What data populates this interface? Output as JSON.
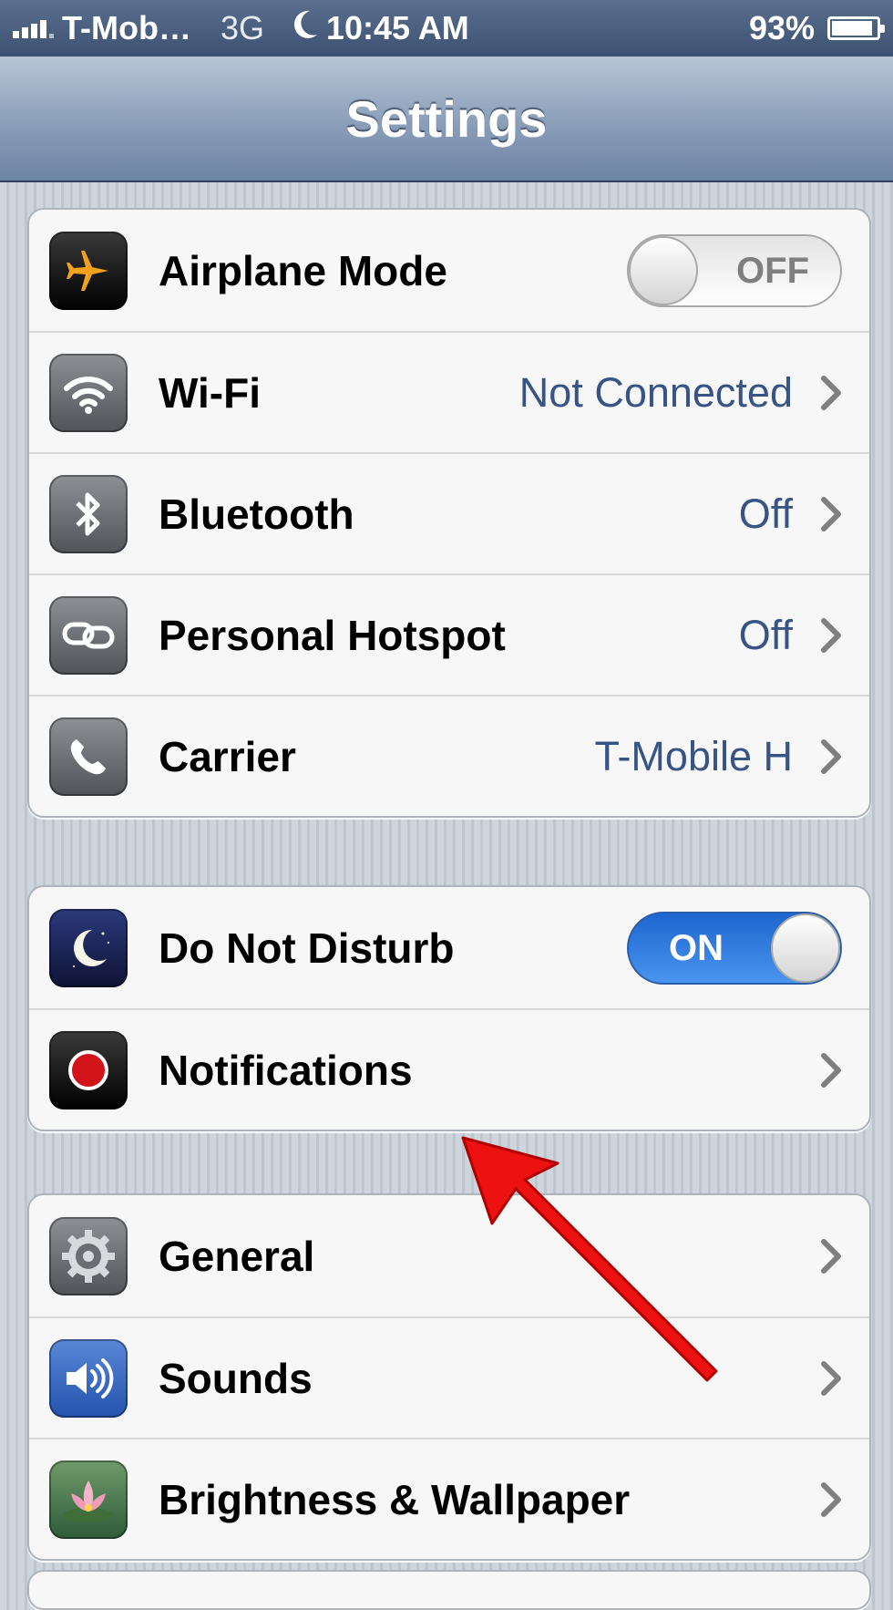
{
  "status_bar": {
    "carrier": "T-Mob…",
    "network": "3G",
    "time": "10:45 AM",
    "battery_percent": "93%",
    "battery_level": 0.93
  },
  "nav": {
    "title": "Settings"
  },
  "groups": [
    {
      "rows": [
        {
          "label": "Airplane Mode",
          "icon": "airplane-icon",
          "control": "toggle",
          "toggle_text": "OFF"
        },
        {
          "label": "Wi-Fi",
          "icon": "wifi-icon",
          "value": "Not Connected"
        },
        {
          "label": "Bluetooth",
          "icon": "bluetooth-icon",
          "value": "Off"
        },
        {
          "label": "Personal Hotspot",
          "icon": "hotspot-icon",
          "value": "Off"
        },
        {
          "label": "Carrier",
          "icon": "phone-icon",
          "value": "T-Mobile H"
        }
      ]
    },
    {
      "rows": [
        {
          "label": "Do Not Disturb",
          "icon": "moon-icon",
          "control": "toggle",
          "toggle_text": "ON"
        },
        {
          "label": "Notifications",
          "icon": "notifications-icon"
        }
      ]
    },
    {
      "rows": [
        {
          "label": "General",
          "icon": "gear-icon"
        },
        {
          "label": "Sounds",
          "icon": "speaker-icon"
        },
        {
          "label": "Brightness & Wallpaper",
          "icon": "lotus-icon"
        }
      ]
    }
  ],
  "colors": {
    "value_text": "#385487",
    "toggle_on": "#1d66d0",
    "annotation_arrow": "#ee1111"
  }
}
